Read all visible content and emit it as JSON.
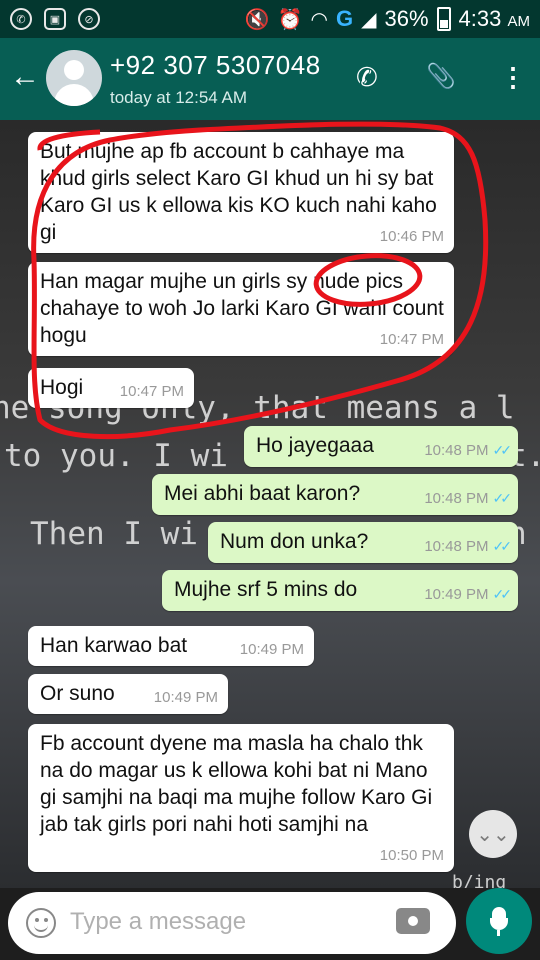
{
  "status_bar": {
    "icons_left": [
      "whatsapp-icon",
      "gallery-icon",
      "block-icon"
    ],
    "mute": "🔇",
    "alarm": "⏰",
    "network": "G",
    "battery": "36%",
    "time": "4:33",
    "ampm": "AM"
  },
  "header": {
    "back": "←",
    "contact_name": "+92 307 5307048",
    "last_seen": "today at 12:54 AM",
    "call": "✆",
    "attach": "📎",
    "menu": "⋮",
    "color": "#075e54"
  },
  "background_text": [
    "he song only, that means a l",
    "to you. I wi",
    "t.",
    "Then I wi",
    "n",
    "b/ing"
  ],
  "messages": [
    {
      "dir": "in",
      "text": "But mujhe ap fb account b cahhaye ma khud girls select Karo GI khud un hi sy bat Karo GI us k ellowa kis KO kuch nahi kaho gi",
      "time": "10:46 PM"
    },
    {
      "dir": "in",
      "text": "Han magar mujhe un girls sy nude pics chahaye to woh Jo larki Karo GI wahi count hogu",
      "time": "10:47 PM"
    },
    {
      "dir": "in",
      "text": "Hogi",
      "time": "10:47 PM"
    },
    {
      "dir": "out",
      "text": "Ho jayegaaa",
      "time": "10:48 PM",
      "ticks": "✓✓"
    },
    {
      "dir": "out",
      "text": "Mei abhi baat karon?",
      "time": "10:48 PM",
      "ticks": "✓✓"
    },
    {
      "dir": "out",
      "text": "Num don unka?",
      "time": "10:48 PM",
      "ticks": "✓✓"
    },
    {
      "dir": "out",
      "text": "Mujhe srf 5 mins do",
      "time": "10:49 PM",
      "ticks": "✓✓"
    },
    {
      "dir": "in",
      "text": "Han karwao bat",
      "time": "10:49 PM"
    },
    {
      "dir": "in",
      "text": "Or suno",
      "time": "10:49 PM"
    },
    {
      "dir": "in",
      "text": "Fb account dyene ma masla ha chalo thk na do magar us k ellowa kohi bat ni Mano gi samjhi na baqi ma mujhe follow Karo Gi jab tak girls pori nahi hoti samjhi na",
      "time": "10:50 PM"
    }
  ],
  "scroll_button": "⌄⌄",
  "input": {
    "placeholder": "Type a message"
  },
  "colors": {
    "outgoing": "#dcf8c6",
    "incoming": "#ffffff",
    "annotation": "#e8141b",
    "mic": "#00897b"
  }
}
